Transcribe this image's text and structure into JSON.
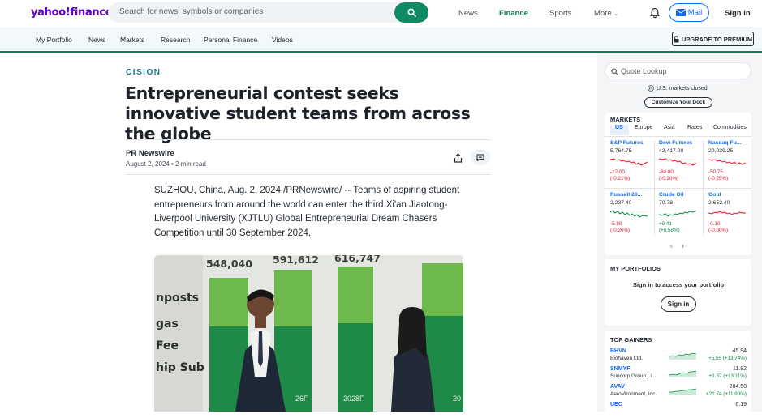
{
  "header": {
    "logo": "yahoo!finance",
    "search_placeholder": "Search for news, symbols or companies",
    "nav": [
      "News",
      "Finance",
      "Sports",
      "More"
    ],
    "mail_label": "Mail",
    "signin_label": "Sign in"
  },
  "subnav": {
    "items": [
      "My Portfolio",
      "News",
      "Markets",
      "Research",
      "Personal Finance",
      "Videos"
    ],
    "upgrade_label": "UPGRADE TO PREMIUM"
  },
  "article": {
    "source_logo": "CISION",
    "headline": "Entrepreneurial contest seeks innovative student teams from across the globe",
    "author": "PR Newswire",
    "meta": "August 2, 2024 • 2 min read",
    "body": "SUZHOU, China, Aug. 2, 2024 /PRNewswire/ -- Teams of aspiring student entrepreneurs from around the world can enter the third Xi'an Jiaotong-Liverpool University (XJTLU) Global Entrepreneurial Dream Chasers Competition until 30 September 2024.",
    "photo": {
      "numbers": [
        "548,040",
        "591,612",
        "616,747"
      ],
      "left_text": [
        "nposts",
        "gas",
        "Fee",
        "hip Sub"
      ],
      "bottom_labels": [
        "26F",
        "2028F",
        "20"
      ]
    }
  },
  "sidebar": {
    "quote_placeholder": "Quote Lookup",
    "market_status": "U.S. markets closed",
    "customize_label": "Customize Your Dock",
    "markets_title": "MARKETS",
    "market_tabs": [
      "US",
      "Europe",
      "Asia",
      "Rates",
      "Commodities"
    ],
    "active_tab": "US",
    "tiles": [
      {
        "name": "S&P Futures",
        "price": "5,764.75",
        "change": "-12.00",
        "pct": "(-0.21%)",
        "dir": "neg"
      },
      {
        "name": "Dow Futures",
        "price": "42,417.00",
        "change": "-84.00",
        "pct": "(-0.20%)",
        "dir": "neg"
      },
      {
        "name": "Nasdaq Fu...",
        "price": "20,029.25",
        "change": "-50.75",
        "pct": "(-0.25%)",
        "dir": "neg"
      },
      {
        "name": "Russell 20...",
        "price": "2,237.40",
        "change": "-5.80",
        "pct": "(-0.26%)",
        "dir": "neg"
      },
      {
        "name": "Crude Oil",
        "price": "70.78",
        "change": "+0.41",
        "pct": "(+0.58%)",
        "dir": "pos"
      },
      {
        "name": "Gold",
        "price": "2,652.40",
        "change": "-0.10",
        "pct": "(-0.00%)",
        "dir": "neg"
      }
    ],
    "portfolios_title": "MY PORTFOLIOS",
    "portfolios_msg": "Sign in to access your portfolio",
    "portfolios_signin": "Sign in",
    "gainers_title": "TOP GAINERS",
    "gainers": [
      {
        "symbol": "BHVN",
        "name": "Biohaven Ltd.",
        "price": "45.94",
        "change": "+5.55 (+13.74%)"
      },
      {
        "symbol": "SNMYF",
        "name": "Suncorp Group Li...",
        "price": "11.82",
        "change": "+1.37 (+13.11%)"
      },
      {
        "symbol": "AVAV",
        "name": "AeroVironment, Inc.",
        "price": "204.50",
        "change": "+21.74 (+11.90%)"
      },
      {
        "symbol": "UEC",
        "name": "",
        "price": "6.19",
        "change": ""
      }
    ],
    "colors": {
      "up": "#008a3e",
      "down": "#eb0f29",
      "link": "#0f69ff",
      "brand": "#6001d2",
      "accent": "#0f8a65"
    }
  }
}
